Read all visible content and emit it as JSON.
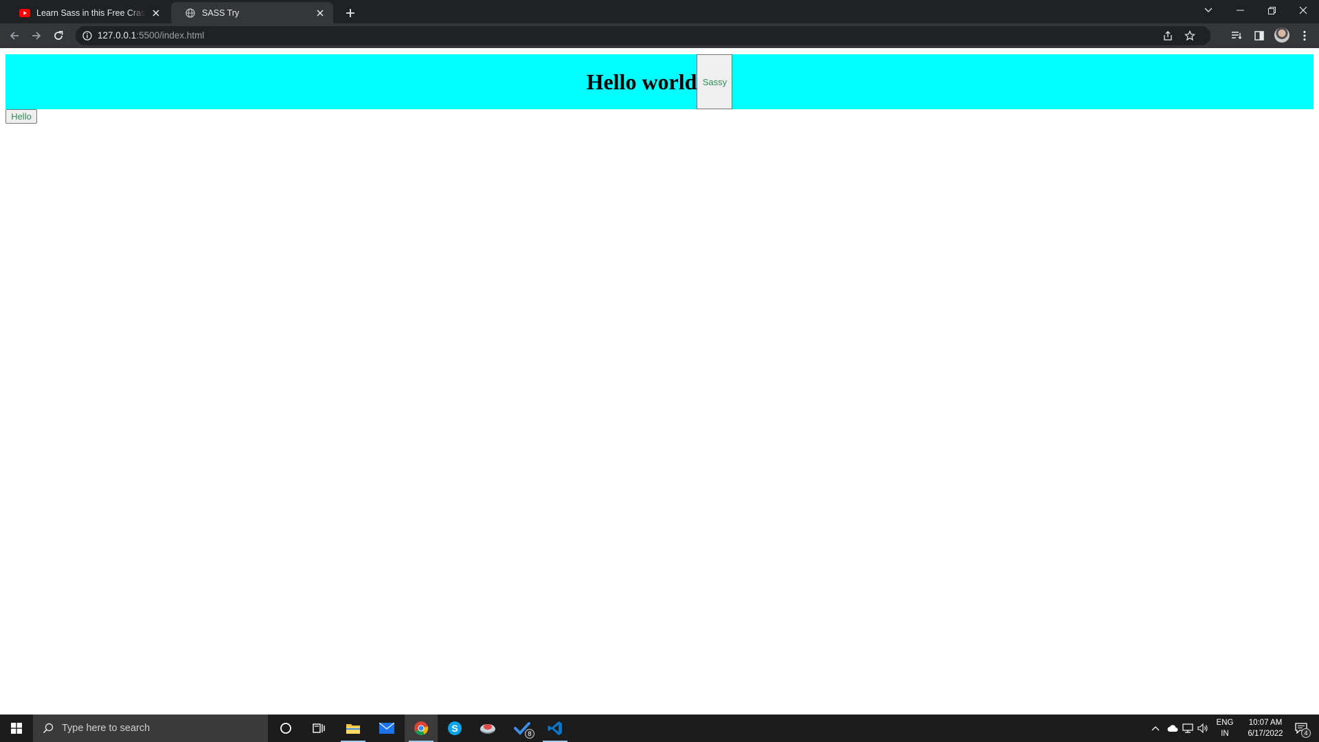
{
  "browser": {
    "tabs": [
      {
        "title": "Learn Sass in this Free Crash Course",
        "favicon": "youtube-icon",
        "active": false
      },
      {
        "title": "SASS Try",
        "favicon": "globe-icon",
        "active": true
      }
    ],
    "address": {
      "host": "127.0.0.1",
      "rest": ":5500/index.html"
    }
  },
  "page": {
    "heading": "Hello world",
    "sassy_button": "Sassy",
    "hello_button": "Hello"
  },
  "taskbar": {
    "search_placeholder": "Type here to search",
    "language": {
      "line1": "ENG",
      "line2": "IN"
    },
    "clock": {
      "time": "10:07 AM",
      "date": "6/17/2022"
    },
    "todo_badge": "8",
    "notification_count": "4"
  },
  "colors": {
    "header_bg": "#00ffff",
    "button_text": "#2e8b57",
    "chrome_frame": "#202124",
    "chrome_toolbar": "#35363a"
  }
}
